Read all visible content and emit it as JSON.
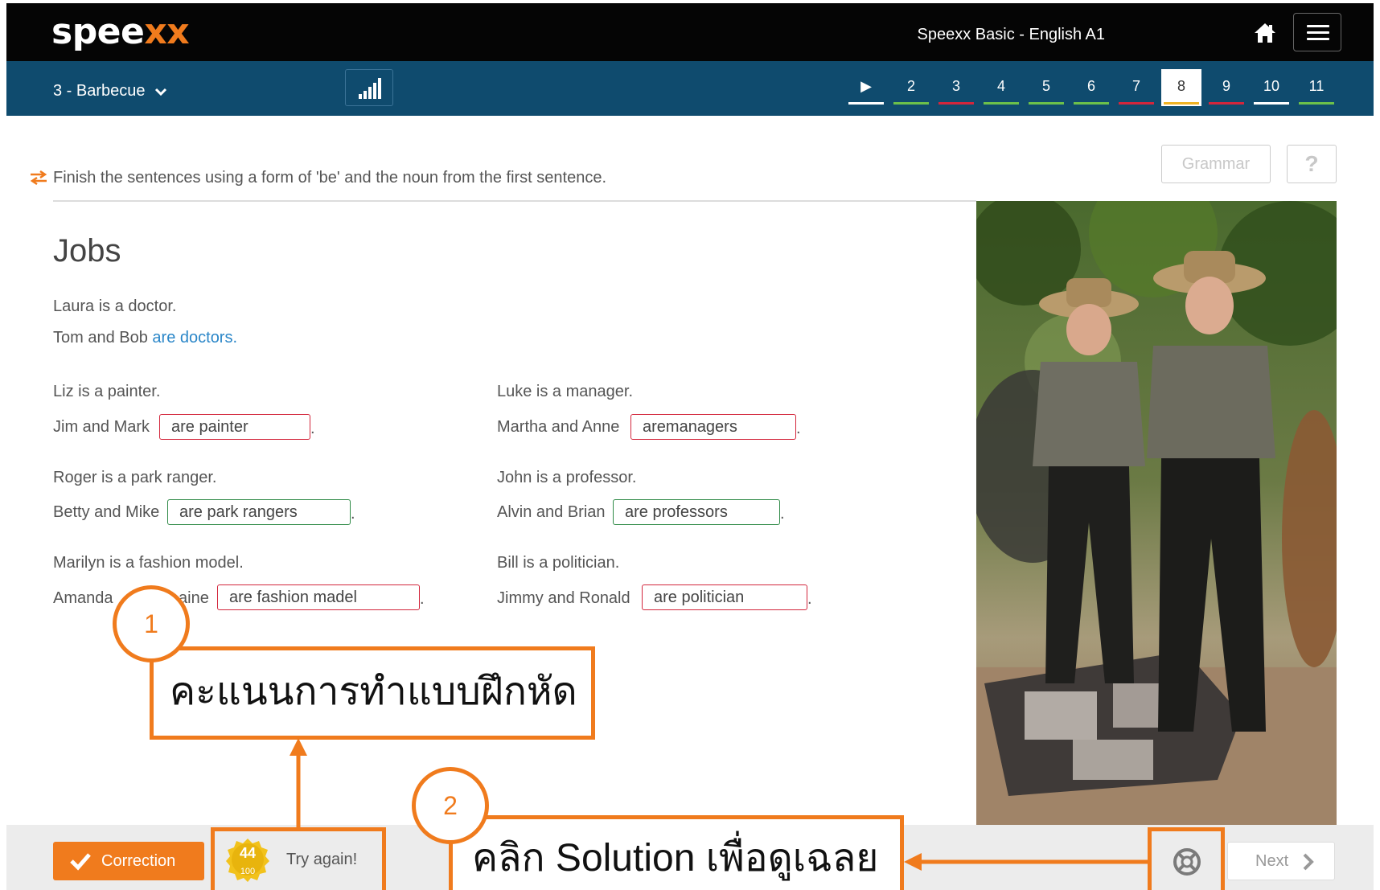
{
  "header": {
    "logo_main": "spee",
    "logo_accent": "xx",
    "course_title": "Speexx Basic - English A1"
  },
  "subnav": {
    "unit_label": "3 - Barbecue",
    "steps": [
      {
        "label": "▶",
        "status": "done",
        "color": "#ffffff"
      },
      {
        "label": "2",
        "status": "correct",
        "color": "#6cc04a"
      },
      {
        "label": "3",
        "status": "wrong",
        "color": "#d3263c"
      },
      {
        "label": "4",
        "status": "correct",
        "color": "#6cc04a"
      },
      {
        "label": "5",
        "status": "correct",
        "color": "#6cc04a"
      },
      {
        "label": "6",
        "status": "correct",
        "color": "#6cc04a"
      },
      {
        "label": "7",
        "status": "wrong",
        "color": "#d3263c"
      },
      {
        "label": "8",
        "status": "current",
        "color": "#f0b323"
      },
      {
        "label": "9",
        "status": "wrong",
        "color": "#d3263c"
      },
      {
        "label": "10",
        "status": "done",
        "color": "#ffffff"
      },
      {
        "label": "11",
        "status": "correct",
        "color": "#6cc04a"
      }
    ]
  },
  "exercise": {
    "instruction": "Finish the sentences using a form of 'be' and the noun from the first sentence.",
    "grammar_label": "Grammar",
    "help_label": "?",
    "title": "Jobs",
    "example": {
      "sentence": "Laura is a doctor.",
      "prompt": "Tom and Bob",
      "answer": "are doctors."
    },
    "items": {
      "liz": {
        "sentence": "Liz is a painter.",
        "prompt": "Jim and Mark",
        "answer": "are painter",
        "correct": false
      },
      "roger": {
        "sentence": "Roger is a park ranger.",
        "prompt": "Betty and Mike",
        "answer": "are park rangers",
        "correct": true
      },
      "marilyn": {
        "sentence": "Marilyn is a fashion model.",
        "prompt": "Amanda",
        "prompt_tail": "aine",
        "answer": "are fashion madel",
        "correct": false
      },
      "luke": {
        "sentence": "Luke is a manager.",
        "prompt": "Martha and Anne",
        "answer": "aremanagers",
        "correct": false
      },
      "john": {
        "sentence": "John is a professor.",
        "prompt": "Alvin and Brian",
        "answer": "are professors",
        "correct": true
      },
      "bill": {
        "sentence": "Bill is a politician.",
        "prompt": "Jimmy and Ronald",
        "answer": "are politician",
        "correct": false
      }
    },
    "period": "."
  },
  "footer": {
    "correction_label": "Correction",
    "score": "44",
    "score_max": "100",
    "result_text": "Try again!",
    "next_label": "Next"
  },
  "annotations": {
    "callout1_number": "1",
    "callout1_text": "คะแนนการทำแบบฝึกหัด",
    "callout2_number": "2",
    "callout2_text": "คลิก Solution เพื่อดูเฉลย"
  },
  "colors": {
    "accent": "#f07b1d",
    "nav_blue": "#0f4b6e",
    "wrong": "#d3263c",
    "right": "#2f8a47",
    "link_blue": "#2a86c8"
  }
}
